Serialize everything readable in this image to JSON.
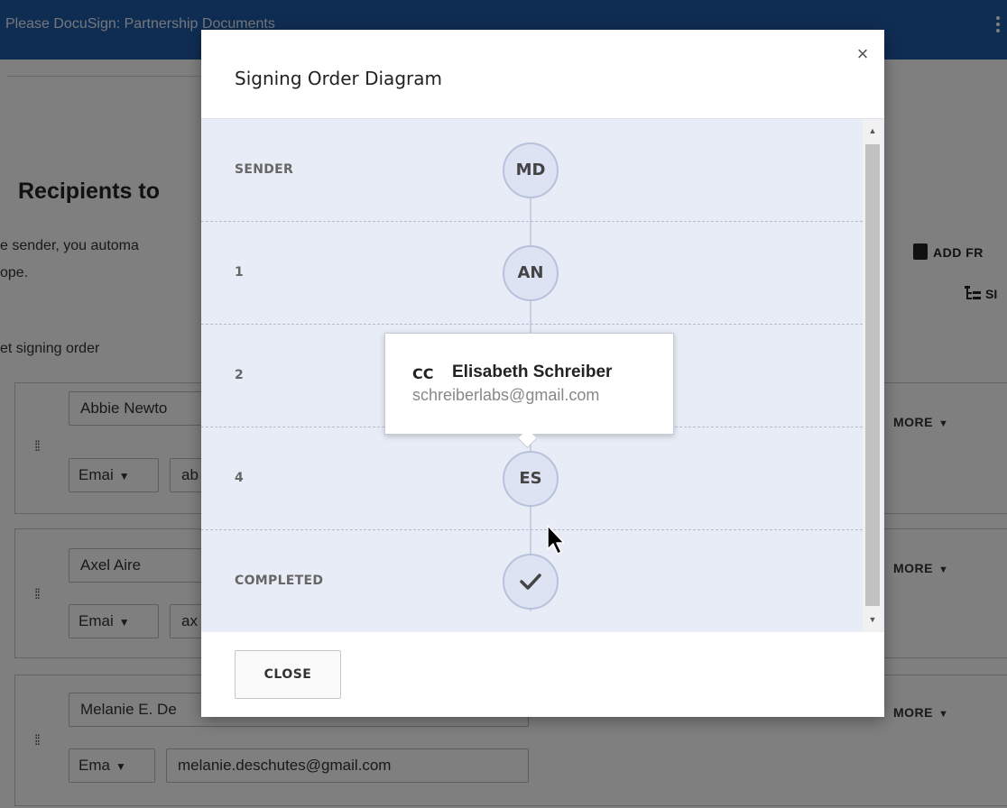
{
  "page": {
    "title": "Please DocuSign: Partnership Documents",
    "heading": "Recipients to",
    "intro_line1": "e sender, you automa",
    "intro_line2": "ope.",
    "add_from": "ADD FR",
    "set_order_action": "SI",
    "set_signing_order": "et signing order",
    "more_label": "MORE",
    "recipients": [
      {
        "name": "Abbie Newto",
        "delivery": "Emai",
        "email": "ab"
      },
      {
        "name": "Axel Aire",
        "delivery": "Emai",
        "email": "ax"
      },
      {
        "name": "Melanie E. De",
        "delivery": "Ema",
        "email": "melanie.deschutes@gmail.com"
      }
    ]
  },
  "modal": {
    "title": "Signing Order Diagram",
    "close_icon": "×",
    "close_button": "CLOSE",
    "steps": [
      {
        "label": "SENDER",
        "initials": "MD"
      },
      {
        "label": "1",
        "initials": "AN"
      },
      {
        "label": "2",
        "initials": ""
      },
      {
        "label": "4",
        "initials": "ES"
      },
      {
        "label": "COMPLETED",
        "icon": "check-icon"
      }
    ],
    "tooltip": {
      "type": "CC",
      "name": "Elisabeth Schreiber",
      "email": "schreiberlabs@gmail.com"
    }
  },
  "colors": {
    "topbar": "#1f5aa5",
    "diagram_bg": "#e8ecf6",
    "node_fill": "#dde3f2",
    "node_border": "#b7c1dc"
  }
}
